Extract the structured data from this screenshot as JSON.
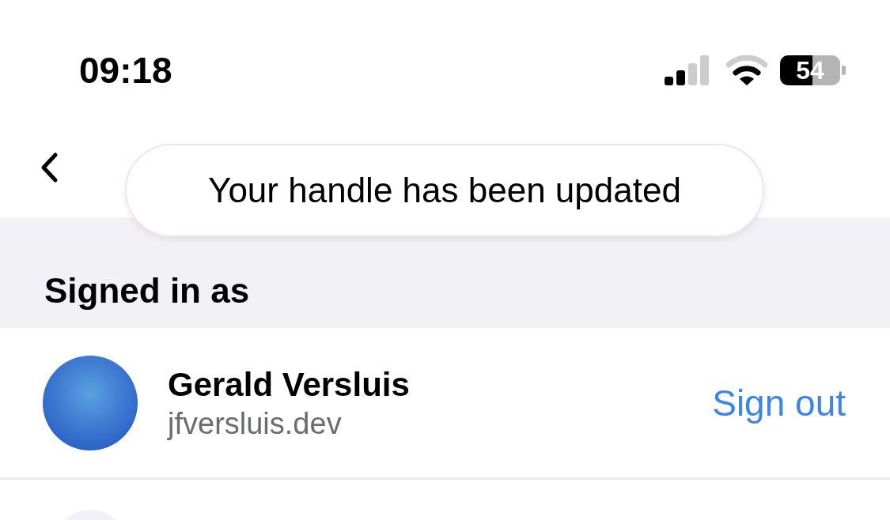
{
  "status_bar": {
    "time": "09:18",
    "battery": "54"
  },
  "toast": {
    "message": "Your handle has been updated"
  },
  "section": {
    "title": "Signed in as"
  },
  "account": {
    "name": "Gerald Versluis",
    "handle": "jfversluis.dev",
    "action": "Sign out"
  }
}
